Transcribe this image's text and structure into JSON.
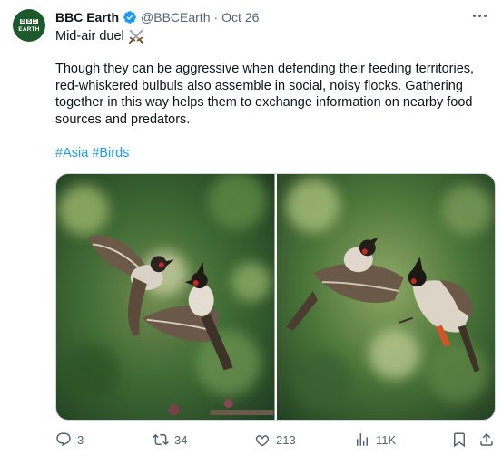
{
  "account": {
    "avatar_top": "BBC",
    "avatar_word": "EARTH",
    "name": "BBC Earth",
    "handle": "@BBCEarth",
    "separator": "·",
    "date": "Oct 26"
  },
  "tweet": {
    "title": "Mid-air duel",
    "body": "Though they can be aggressive when defending their feeding territories, red-whiskered bulbuls also assemble in social, noisy flocks. Gathering together in this way helps them to exchange information on nearby food sources and predators.",
    "hashtags": [
      "#Asia",
      "#Birds"
    ]
  },
  "actions": {
    "replies": "3",
    "reposts": "34",
    "likes": "213",
    "views": "11K"
  },
  "icons": {
    "verified": "verified-badge-icon",
    "more": "more-options-icon",
    "emoji": "crossed-swords-icon",
    "reply": "reply-icon",
    "repost": "repost-icon",
    "like": "heart-icon",
    "views": "views-icon",
    "bookmark": "bookmark-icon",
    "share": "share-icon"
  },
  "colors": {
    "accent": "#1d9bf0",
    "text": "#0f1419",
    "muted": "#536471",
    "avatar_bg": "#1d5a2b"
  }
}
